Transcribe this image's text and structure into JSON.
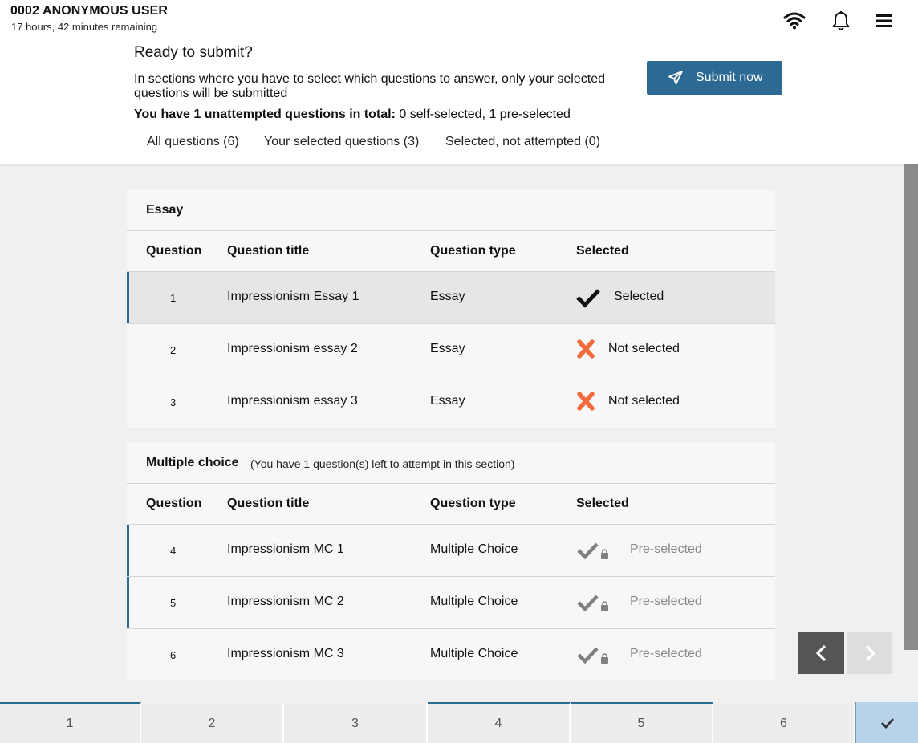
{
  "user": {
    "name": "0002 ANONYMOUS USER",
    "time_remaining": "17 hours, 42 minutes remaining"
  },
  "header_icons": [
    "wifi-icon",
    "bell-icon",
    "menu-icon"
  ],
  "submit_panel": {
    "title": "Ready to submit?",
    "description": "In sections where you have to select which questions to answer, only your selected questions will be submitted",
    "summary_bold": "You have 1 unattempted questions in total:",
    "summary_rest": " 0 self-selected, 1 pre-selected",
    "submit_label": "Submit now"
  },
  "filters": [
    {
      "label": "All questions (6)"
    },
    {
      "label": "Your selected questions (3)"
    },
    {
      "label": "Selected, not attempted (0)"
    }
  ],
  "columns": {
    "question": "Question",
    "title": "Question title",
    "type": "Question type",
    "selected": "Selected"
  },
  "sections": [
    {
      "title": "Essay",
      "note": "",
      "rows": [
        {
          "num": "1",
          "title": "Impressionism Essay 1",
          "type": "Essay",
          "status": "Selected",
          "icon": "check-icon"
        },
        {
          "num": "2",
          "title": "Impressionism essay 2",
          "type": "Essay",
          "status": "Not selected",
          "icon": "cross-icon"
        },
        {
          "num": "3",
          "title": "Impressionism essay 3",
          "type": "Essay",
          "status": "Not selected",
          "icon": "cross-icon"
        }
      ]
    },
    {
      "title": "Multiple choice",
      "note": "(You have 1 question(s) left to attempt in this section)",
      "rows": [
        {
          "num": "4",
          "title": "Impressionism MC 1",
          "type": "Multiple Choice",
          "status": "Pre-selected",
          "icon": "locked-check-icon"
        },
        {
          "num": "5",
          "title": "Impressionism MC 2",
          "type": "Multiple Choice",
          "status": "Pre-selected",
          "icon": "locked-check-icon"
        },
        {
          "num": "6",
          "title": "Impressionism MC 3",
          "type": "Multiple Choice",
          "status": "Pre-selected",
          "icon": "locked-check-icon"
        }
      ]
    }
  ],
  "nav": {
    "prev_icon": "chevron-left-icon",
    "next_icon": "chevron-right-icon"
  },
  "bottom_tabs": [
    "1",
    "2",
    "3",
    "4",
    "5",
    "6"
  ],
  "bottom_check_icon": "check-icon",
  "colors": {
    "accent": "#2c6a94",
    "error": "#f26a3d",
    "muted": "#888888",
    "submit_tab": "#b8d2ea"
  }
}
